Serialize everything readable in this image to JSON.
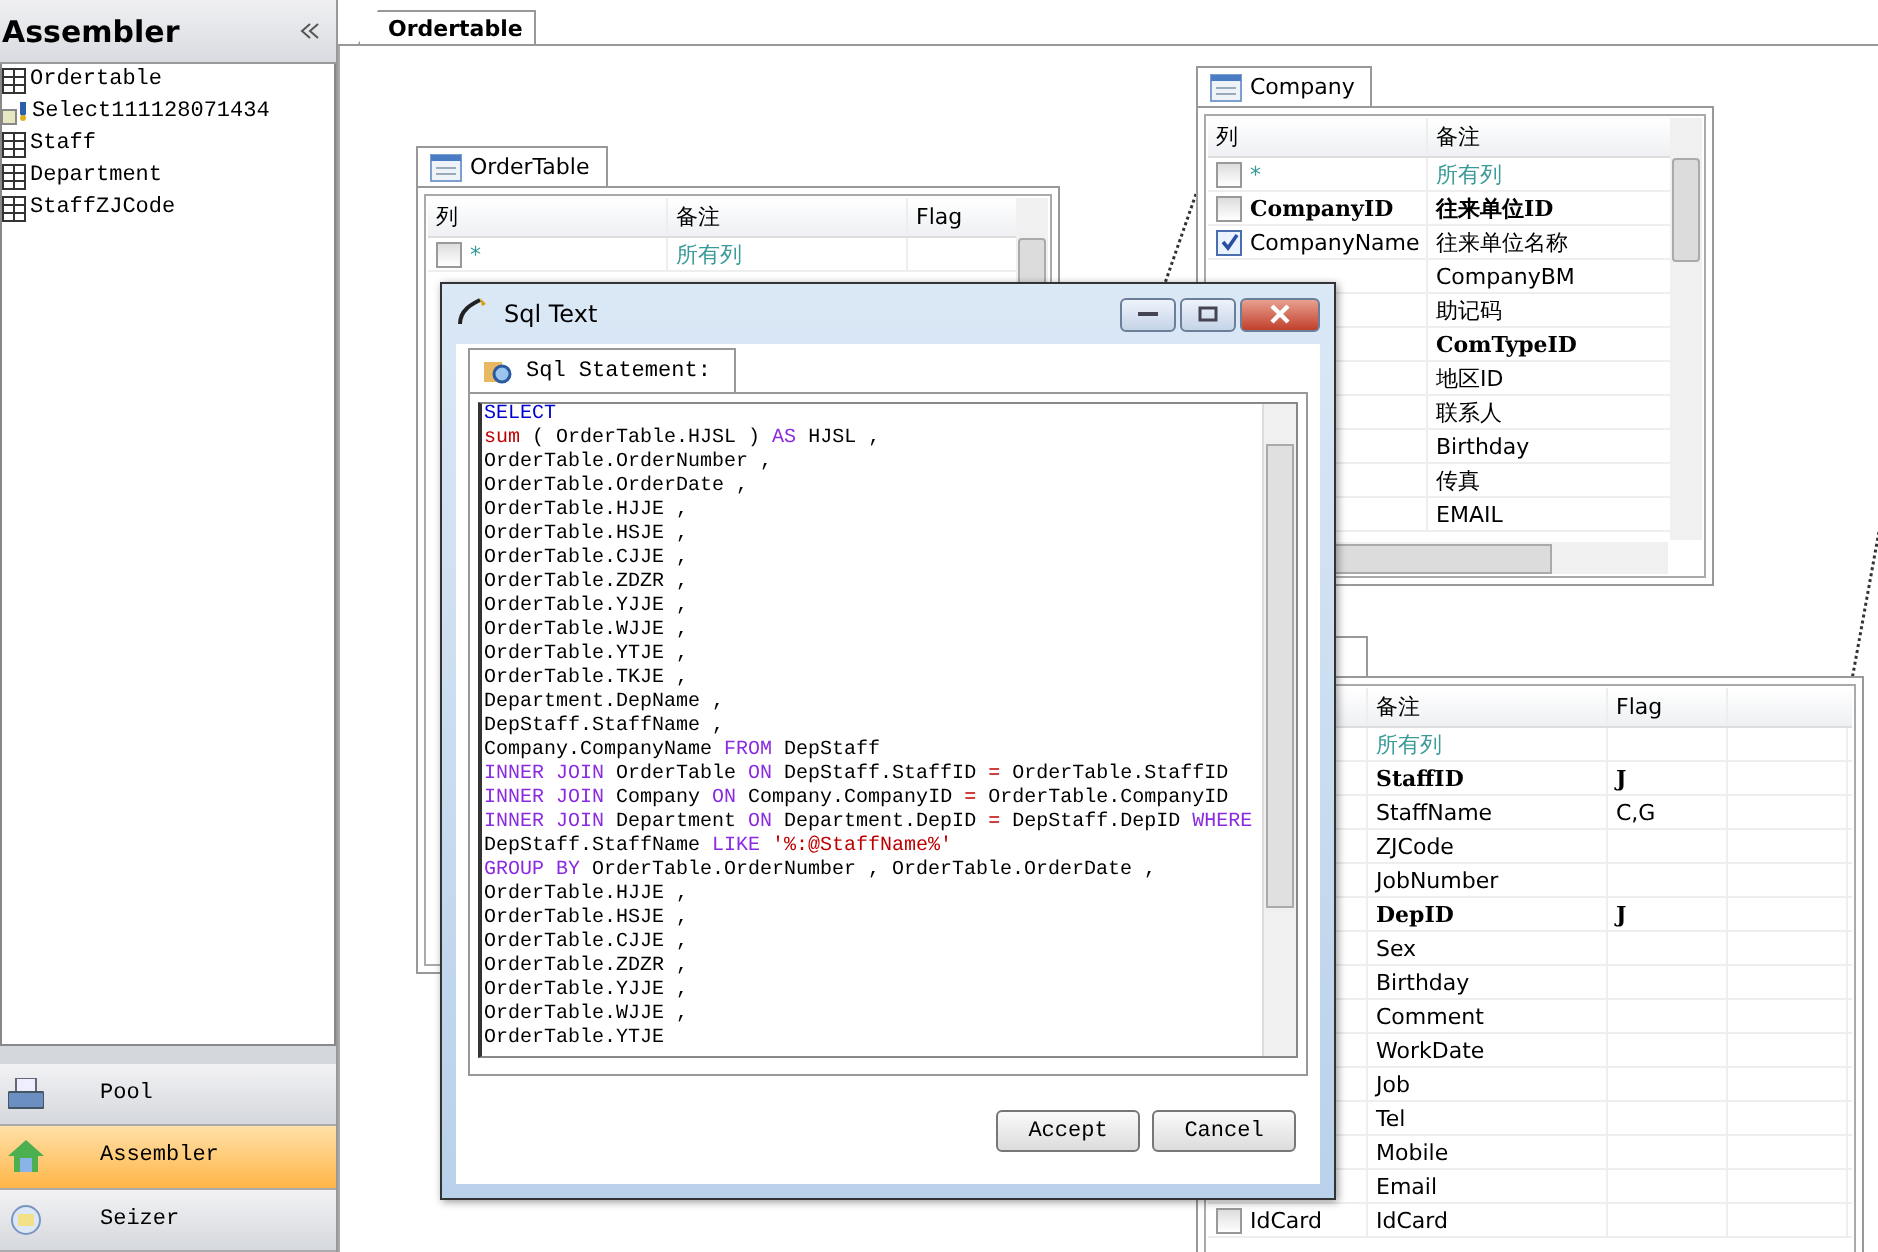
{
  "sidebar": {
    "title": "Assembler",
    "items": [
      {
        "label": "Ordertable",
        "kind": "table"
      },
      {
        "label": "Select111128071434",
        "kind": "query"
      },
      {
        "label": "Staff",
        "kind": "table"
      },
      {
        "label": "Department",
        "kind": "table"
      },
      {
        "label": "StaffZJCode",
        "kind": "table"
      }
    ]
  },
  "nav": [
    {
      "label": "Pool",
      "selected": false,
      "kind": "pool"
    },
    {
      "label": "Assembler",
      "selected": true,
      "kind": "home"
    },
    {
      "label": "Seizer",
      "selected": false,
      "kind": "seizer"
    }
  ],
  "tabs": [
    {
      "label": "Ordertable",
      "selected": true
    }
  ],
  "tables": [
    {
      "title": "OrderTable",
      "columns": [
        "列",
        "备注",
        "Flag"
      ],
      "rows": [
        {
          "name": "*",
          "note": "所有列",
          "checked": false,
          "kind": "all"
        }
      ]
    },
    {
      "title": "Company",
      "columns": [
        "列",
        "备注"
      ],
      "rows": [
        {
          "name": "*",
          "note": "所有列",
          "checked": false,
          "kind": "all"
        },
        {
          "name": "CompanyID",
          "note": "往来单位ID",
          "checked": false,
          "key": true
        },
        {
          "name": "CompanyName",
          "note": "往来单位名称",
          "checked": true
        },
        {
          "note": "CompanyBM"
        },
        {
          "note": "助记码"
        },
        {
          "note": "ComTypeID",
          "key": true
        },
        {
          "note": "地区ID"
        },
        {
          "note": "联系人"
        },
        {
          "note": "Birthday"
        },
        {
          "note": "传真"
        },
        {
          "note": "EMAIL"
        }
      ]
    },
    {
      "columns": [
        "备注",
        "Flag"
      ],
      "rows": [
        {
          "note": "所有列",
          "kind": "all"
        },
        {
          "note": "StaffID",
          "flag": "J",
          "key": true
        },
        {
          "note": "StaffName",
          "flag": "C,G"
        },
        {
          "note": "ZJCode"
        },
        {
          "note": "JobNumber"
        },
        {
          "note": "DepID",
          "flag": "J",
          "key": true
        },
        {
          "note": "Sex"
        },
        {
          "note": "Birthday"
        },
        {
          "note": "Comment"
        },
        {
          "note": "WorkDate"
        },
        {
          "note": "Job"
        },
        {
          "note": "Tel"
        },
        {
          "note": "Mobile"
        },
        {
          "note": "Email"
        },
        {
          "name": "IdCard",
          "note": "IdCard",
          "checked": false
        }
      ]
    }
  ],
  "dialog": {
    "title": "Sql Text",
    "tab": "Sql Statement:",
    "sql": [
      [
        {
          "t": "SELECT",
          "kind": "select"
        }
      ],
      [
        {
          "t": "sum",
          "kind": "func"
        },
        {
          "t": " ( OrderTable.HJSL ) "
        },
        {
          "t": "AS",
          "kind": "kw"
        },
        {
          "t": " HJSL ,"
        }
      ],
      [
        {
          "t": "OrderTable.OrderNumber ,"
        }
      ],
      [
        {
          "t": "OrderTable.OrderDate ,"
        }
      ],
      [
        {
          "t": "OrderTable.HJJE ,"
        }
      ],
      [
        {
          "t": "OrderTable.HSJE ,"
        }
      ],
      [
        {
          "t": "OrderTable.CJJE ,"
        }
      ],
      [
        {
          "t": "OrderTable.ZDZR ,"
        }
      ],
      [
        {
          "t": "OrderTable.YJJE ,"
        }
      ],
      [
        {
          "t": "OrderTable.WJJE ,"
        }
      ],
      [
        {
          "t": "OrderTable.YTJE ,"
        }
      ],
      [
        {
          "t": "OrderTable.TKJE ,"
        }
      ],
      [
        {
          "t": "Department.DepName ,"
        }
      ],
      [
        {
          "t": "DepStaff.StaffName ,"
        }
      ],
      [
        {
          "t": "Company.CompanyName "
        },
        {
          "t": "FROM",
          "kind": "kw"
        },
        {
          "t": " DepStaff"
        }
      ],
      [
        {
          "t": "INNER JOIN",
          "kind": "kw"
        },
        {
          "t": " OrderTable "
        },
        {
          "t": "ON",
          "kind": "kw"
        },
        {
          "t": " DepStaff.StaffID "
        },
        {
          "t": "=",
          "kind": "func"
        },
        {
          "t": " OrderTable.StaffID"
        }
      ],
      [
        {
          "t": "INNER JOIN",
          "kind": "kw"
        },
        {
          "t": " Company "
        },
        {
          "t": "ON",
          "kind": "kw"
        },
        {
          "t": " Company.CompanyID "
        },
        {
          "t": "=",
          "kind": "func"
        },
        {
          "t": " OrderTable.CompanyID"
        }
      ],
      [
        {
          "t": "INNER JOIN",
          "kind": "kw"
        },
        {
          "t": " Department "
        },
        {
          "t": "ON",
          "kind": "kw"
        },
        {
          "t": " Department.DepID "
        },
        {
          "t": "=",
          "kind": "func"
        },
        {
          "t": " DepStaff.DepID "
        },
        {
          "t": "WHERE",
          "kind": "kw"
        }
      ],
      [
        {
          "t": "DepStaff.StaffName "
        },
        {
          "t": "LIKE",
          "kind": "kw"
        },
        {
          "t": " '%:@StaffName%'",
          "kind": "func"
        }
      ],
      [
        {
          "t": "GROUP BY",
          "kind": "kw"
        },
        {
          "t": " OrderTable.OrderNumber , OrderTable.OrderDate ,"
        }
      ],
      [
        {
          "t": "OrderTable.HJJE ,"
        }
      ],
      [
        {
          "t": "OrderTable.HSJE ,"
        }
      ],
      [
        {
          "t": "OrderTable.CJJE ,"
        }
      ],
      [
        {
          "t": "OrderTable.ZDZR ,"
        }
      ],
      [
        {
          "t": "OrderTable.YJJE ,"
        }
      ],
      [
        {
          "t": "OrderTable.WJJE ,"
        }
      ],
      [
        {
          "t": "OrderTable.YTJE"
        }
      ]
    ],
    "buttons": [
      "Accept",
      "Cancel"
    ]
  }
}
